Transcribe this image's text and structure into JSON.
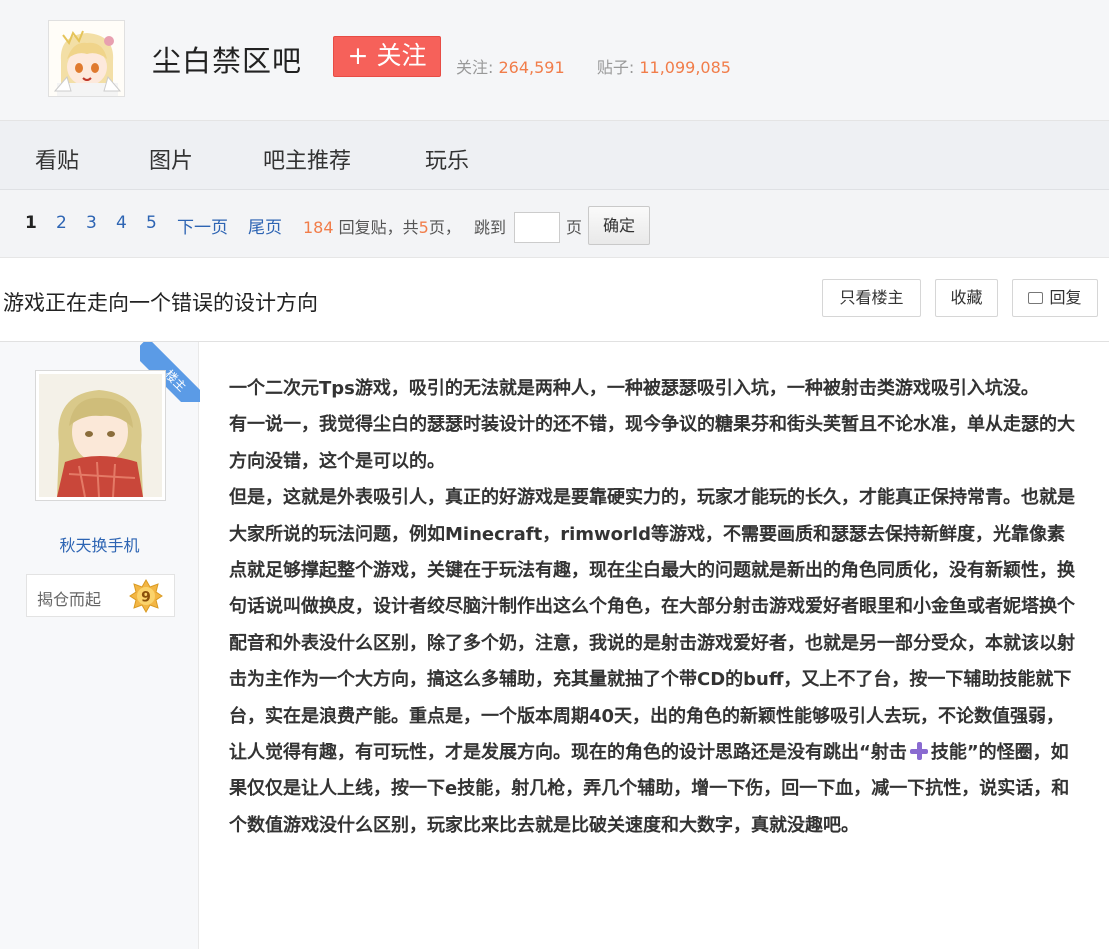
{
  "forum": {
    "name": "尘白禁区吧",
    "follow_label": "+ 关注",
    "followers_label": "关注:",
    "followers": "264,591",
    "posts_label": "贴子:",
    "posts": "11,099,085"
  },
  "nav": {
    "items": [
      "看贴",
      "图片",
      "吧主推荐",
      "玩乐"
    ]
  },
  "pager": {
    "pages": [
      "1",
      "2",
      "3",
      "4",
      "5"
    ],
    "next": "下一页",
    "last": "尾页",
    "reply_count": "184",
    "reply_suffix": "回复贴，共",
    "total_pages": "5",
    "total_suffix": "页，",
    "jump_label": "跳到",
    "page_unit": "页",
    "confirm": "确定"
  },
  "thread": {
    "title": "游戏正在走向一个错误的设计方向",
    "only_author": "只看楼主",
    "favorite": "收藏",
    "reply": "回复"
  },
  "post": {
    "badge": "楼主",
    "author": "秋天换手机",
    "level_title": "揭仓而起",
    "level": "9",
    "paragraphs": [
      "一个二次元Tps游戏，吸引的无法就是两种人，一种被瑟瑟吸引入坑，一种被射击类游戏吸引入坑没。",
      "有一说一，我觉得尘白的瑟瑟时装设计的还不错，现今争议的糖果芬和街头芙暂且不论水准，单从走瑟的大方向没错，这个是可以的。",
      "但是，这就是外表吸引人，真正的好游戏是要靠硬实力的，玩家才能玩的长久，才能真正保持常青。也就是大家所说的玩法问题，例如Minecraft，rimworld等游戏，不需要画质和瑟瑟去保持新鲜度，光靠像素点就足够撑起整个游戏，关键在于玩法有趣，现在尘白最大的问题就是新出的角色同质化，没有新颖性，换句话说叫做换皮，设计者绞尽脑汁制作出这么个角色，在大部分射击游戏爱好者眼里和小金鱼或者妮塔换个配音和外表没什么区别，除了多个奶，注意，我说的是射击游戏爱好者，也就是另一部分受众，本就该以射击为主作为一个大方向，搞这么多辅助，充其量就抽了个带CD的buff，又上不了台，按一下辅助技能就下台，实在是浪费产能。重点是，一个版本周期40天，出的角色的新颖性能够吸引人去玩，不论数值强弱，让人觉得有趣，有可玩性，才是发展方向。现在的角色的设计思路还是没有跳出“射击"
    ],
    "para3_tail": "技能”的怪圈，如果仅仅是让人上线，按一下e技能，射几枪，弄几个辅助，增一下伤，回一下血，减一下抗性，说实话，和个数值游戏没什么区别，玩家比来比去就是比破关速度和大数字，真就没趣吧。"
  },
  "colors": {
    "follow_button": "#f6615a",
    "link": "#2d64b3",
    "stat_number": "#f17d4a",
    "badge_ribbon": "#5b9be6"
  }
}
